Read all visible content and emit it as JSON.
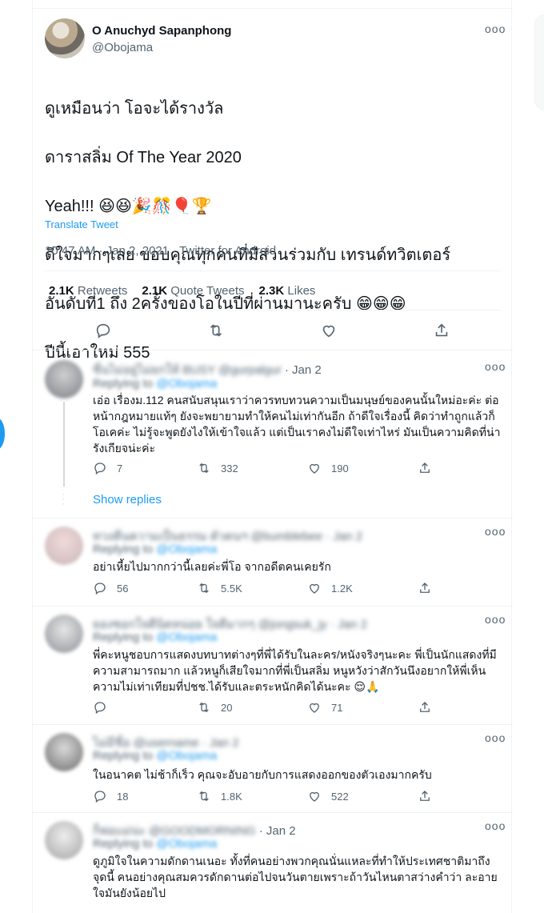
{
  "tweet": {
    "author_name": "O Anuchyd Sapanphong",
    "author_handle": "@Obojama",
    "more": "ooo",
    "lines": [
      "ดูเหมือนว่า โอจะได้รางวัล",
      "ดาราสลิ่ม Of The Year 2020",
      "Yeah!!! 😆😆🎉🎊🎈🏆",
      "ดีใจมากๆเลย ขอบคุณทุกคนที่มีส่วนร่วมกับ เทรนด์ทวิตเตอร์",
      "อันดับที่1 ถึง 2ครั้งของโอในปีที่ผ่านมานะครับ 😁😁😁",
      "ปีนี้เอาใหม่ 555"
    ],
    "translate": "Translate Tweet",
    "meta": "10:47 AM · Jan 2, 2021 · Twitter for Android",
    "stats": {
      "retweets_count": "2.1K",
      "retweets_label": "Retweets",
      "quotes_count": "2.1K",
      "quotes_label": "Quote Tweets",
      "likes_count": "2.3K",
      "likes_label": "Likes"
    },
    "icons": [
      "reply-icon",
      "retweet-icon",
      "like-icon",
      "share-icon"
    ]
  },
  "replies": [
    {
      "name_blurred": "ซื่นไม่อยู่ไม่ยกให้ BUSY @gurpalgur",
      "date": "· Jan 2",
      "replying": "Replying to",
      "replying_to": "@Obojama",
      "text": "เอ่อ เรื่องม.112 คนสนับสนุนเราว่าควรทบทวนความเป็นมนุษย์ของคนนั้นใหม่อะค่ะ ต่อหน้ากฎหมายแท้ๆ ยังจะพยายามทำให้คนไม่เท่ากันอีก ถ้าดีใจเรื่องนี้ คิดว่าทำถูกแล้วก็โอเคค่ะ ไม่รู้จะพูดยังไงให้เข้าใจแล้ว แต่เป็นเราคงไม่ดีใจเท่าไหร่ มันเป็นความคิดที่น่ารังเกียจน่ะค่ะ",
      "reply_count": "7",
      "retweet_count": "332",
      "like_count": "190",
      "show_replies": "Show replies"
    },
    {
      "name_blurred": "ทวงคืนความเป็นธรรม ตัวตนฯ @bumblebee · Jan 2",
      "date": "",
      "replying": "Replying to",
      "replying_to": "@Obojama",
      "text": "อย่าเหี้ยไปมากกว่านี้เลยค่ะพี่โอ จากอดีตคนเคยรัก",
      "reply_count": "56",
      "retweet_count": "5.5K",
      "like_count": "1.2K"
    },
    {
      "name_blurred": "ยองซอกใจดีนิดหน่อย ใจดีมากๆ @jongsuk_jy · Jan 2",
      "date": "",
      "replying": "Replying to",
      "replying_to": "@Obojama",
      "text": "พี่คะหนูชอบการแสดงบทบาทต่างๆที่พี่ได้รับในละคร/หนังจริงๆนะคะ พี่เป็นนักแสดงที่มีความสามารถมาก แล้วหนูก็เสียใจมากที่พี่เป็นสลิ่ม หนูหวังว่าสักวันนึงอยากให้พี่เห็นความไม่เท่าเทียมที่ปชช.ได้รับและตระหนักคิดได้นะคะ 😌🙏",
      "reply_count": "",
      "retweet_count": "20",
      "like_count": "71"
    },
    {
      "name_blurred": "ไม่มีชื่อ @username · Jan 2",
      "date": "",
      "replying": "Replying to",
      "replying_to": "@Obojama",
      "text": "ในอนาคต ไม่ช้าก็เร็ว คุณจะอับอายกับการแสดงออกของตัวเองมากครับ",
      "reply_count": "18",
      "retweet_count": "1.8K",
      "like_count": "522"
    },
    {
      "name_blurred": "ก็พ่อแม่น่ะ @GOODMORNING",
      "date": "· Jan 2",
      "replying": "Replying to",
      "replying_to": "@Obojama",
      "text": "ดูภูมิใจในความดักดานเนอะ ทั้งที่คนอย่างพวกคุณนั่นแหละที่ทำให้ประเทศชาติมาถึงจุดนี้ คนอย่างคุณสมควรดักดานต่อไปจนวันตายเพราะถ้าวันไหนตาสว่างคำว่า ละอายใจมันยังน้อยไป",
      "reply_count": "",
      "retweet_count": "",
      "like_count": ""
    }
  ],
  "colors": {
    "accent": "#1d9bf0",
    "text": "#0f1419",
    "secondary": "#536471",
    "border": "#eff3f4"
  }
}
